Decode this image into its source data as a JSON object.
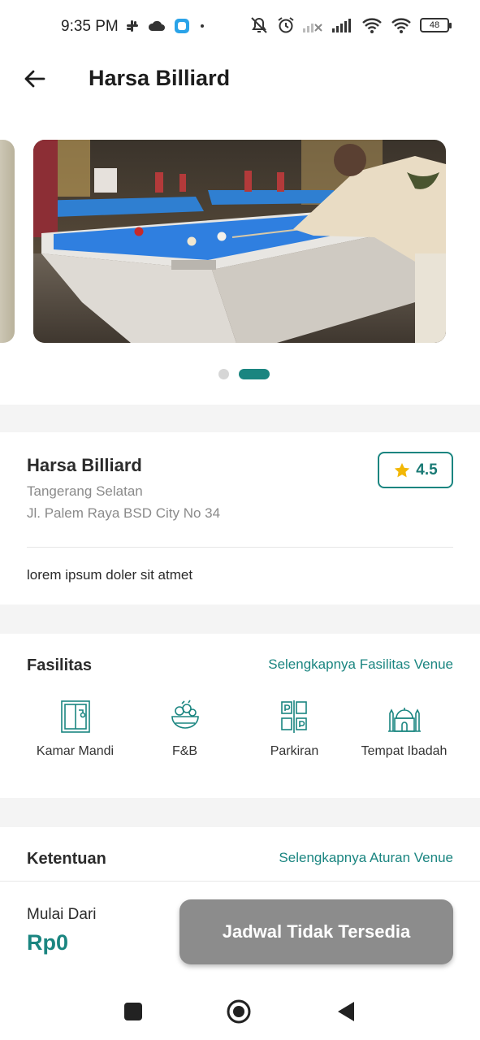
{
  "status_bar": {
    "time": "9:35 PM",
    "battery": "48",
    "left_icons": [
      "slack-icon",
      "cloud-icon",
      "app-icon",
      "dot-icon"
    ],
    "right_icons": [
      "mute-icon",
      "alarm-icon",
      "signal-icon",
      "signal-icon",
      "wifi-icon",
      "wifi-icon",
      "battery-icon"
    ]
  },
  "app_bar": {
    "title": "Harsa Billiard",
    "back_icon": "arrow-left-icon"
  },
  "gallery": {
    "total_slides": 2,
    "active_index": 1
  },
  "venue": {
    "name": "Harsa Billiard",
    "city": "Tangerang Selatan",
    "address": "Jl. Palem Raya BSD City No 34",
    "rating": "4.5",
    "description": "lorem ipsum doler sit atmet"
  },
  "fasilitas": {
    "title": "Fasilitas",
    "link": "Selengkapnya Fasilitas Venue",
    "items": [
      {
        "label": "Kamar Mandi",
        "icon": "shower-icon"
      },
      {
        "label": "F&B",
        "icon": "food-bowl-icon"
      },
      {
        "label": "Parkiran",
        "icon": "parking-icon"
      },
      {
        "label": "Tempat Ibadah",
        "icon": "mosque-icon"
      }
    ]
  },
  "ketentuan": {
    "title": "Ketentuan",
    "link": "Selengkapnya Aturan Venue"
  },
  "booking": {
    "price_label": "Mulai Dari",
    "price_value": "Rp0",
    "cta_label": "Jadwal Tidak Tersedia"
  },
  "colors": {
    "accent": "#1a8580",
    "disabled_button": "#8c8c8c",
    "star": "#f2b705"
  }
}
